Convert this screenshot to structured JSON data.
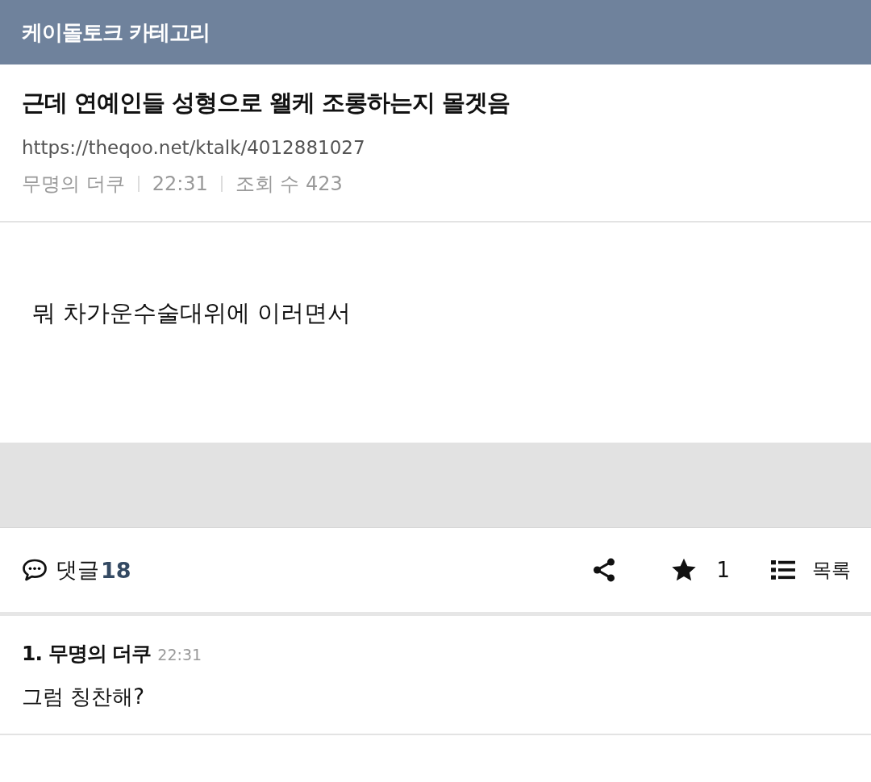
{
  "header": {
    "title": "케이돌토크 카테고리"
  },
  "post": {
    "title": "근데 연예인들 성형으로 왤케 조롱하는지 몰겟음",
    "url": "https://theqoo.net/ktalk/4012881027",
    "author": "무명의 더쿠",
    "time": "22:31",
    "views": "조회 수 423",
    "body": "뭐 차가운수술대위에 이러면서"
  },
  "actions": {
    "comments_label": "댓글",
    "comments_count": "18",
    "star_count": "1",
    "list_label": "목록"
  },
  "comments": [
    {
      "number": "1.",
      "author": "무명의 더쿠",
      "time": "22:31",
      "text": "그럼 칭찬해?"
    }
  ]
}
